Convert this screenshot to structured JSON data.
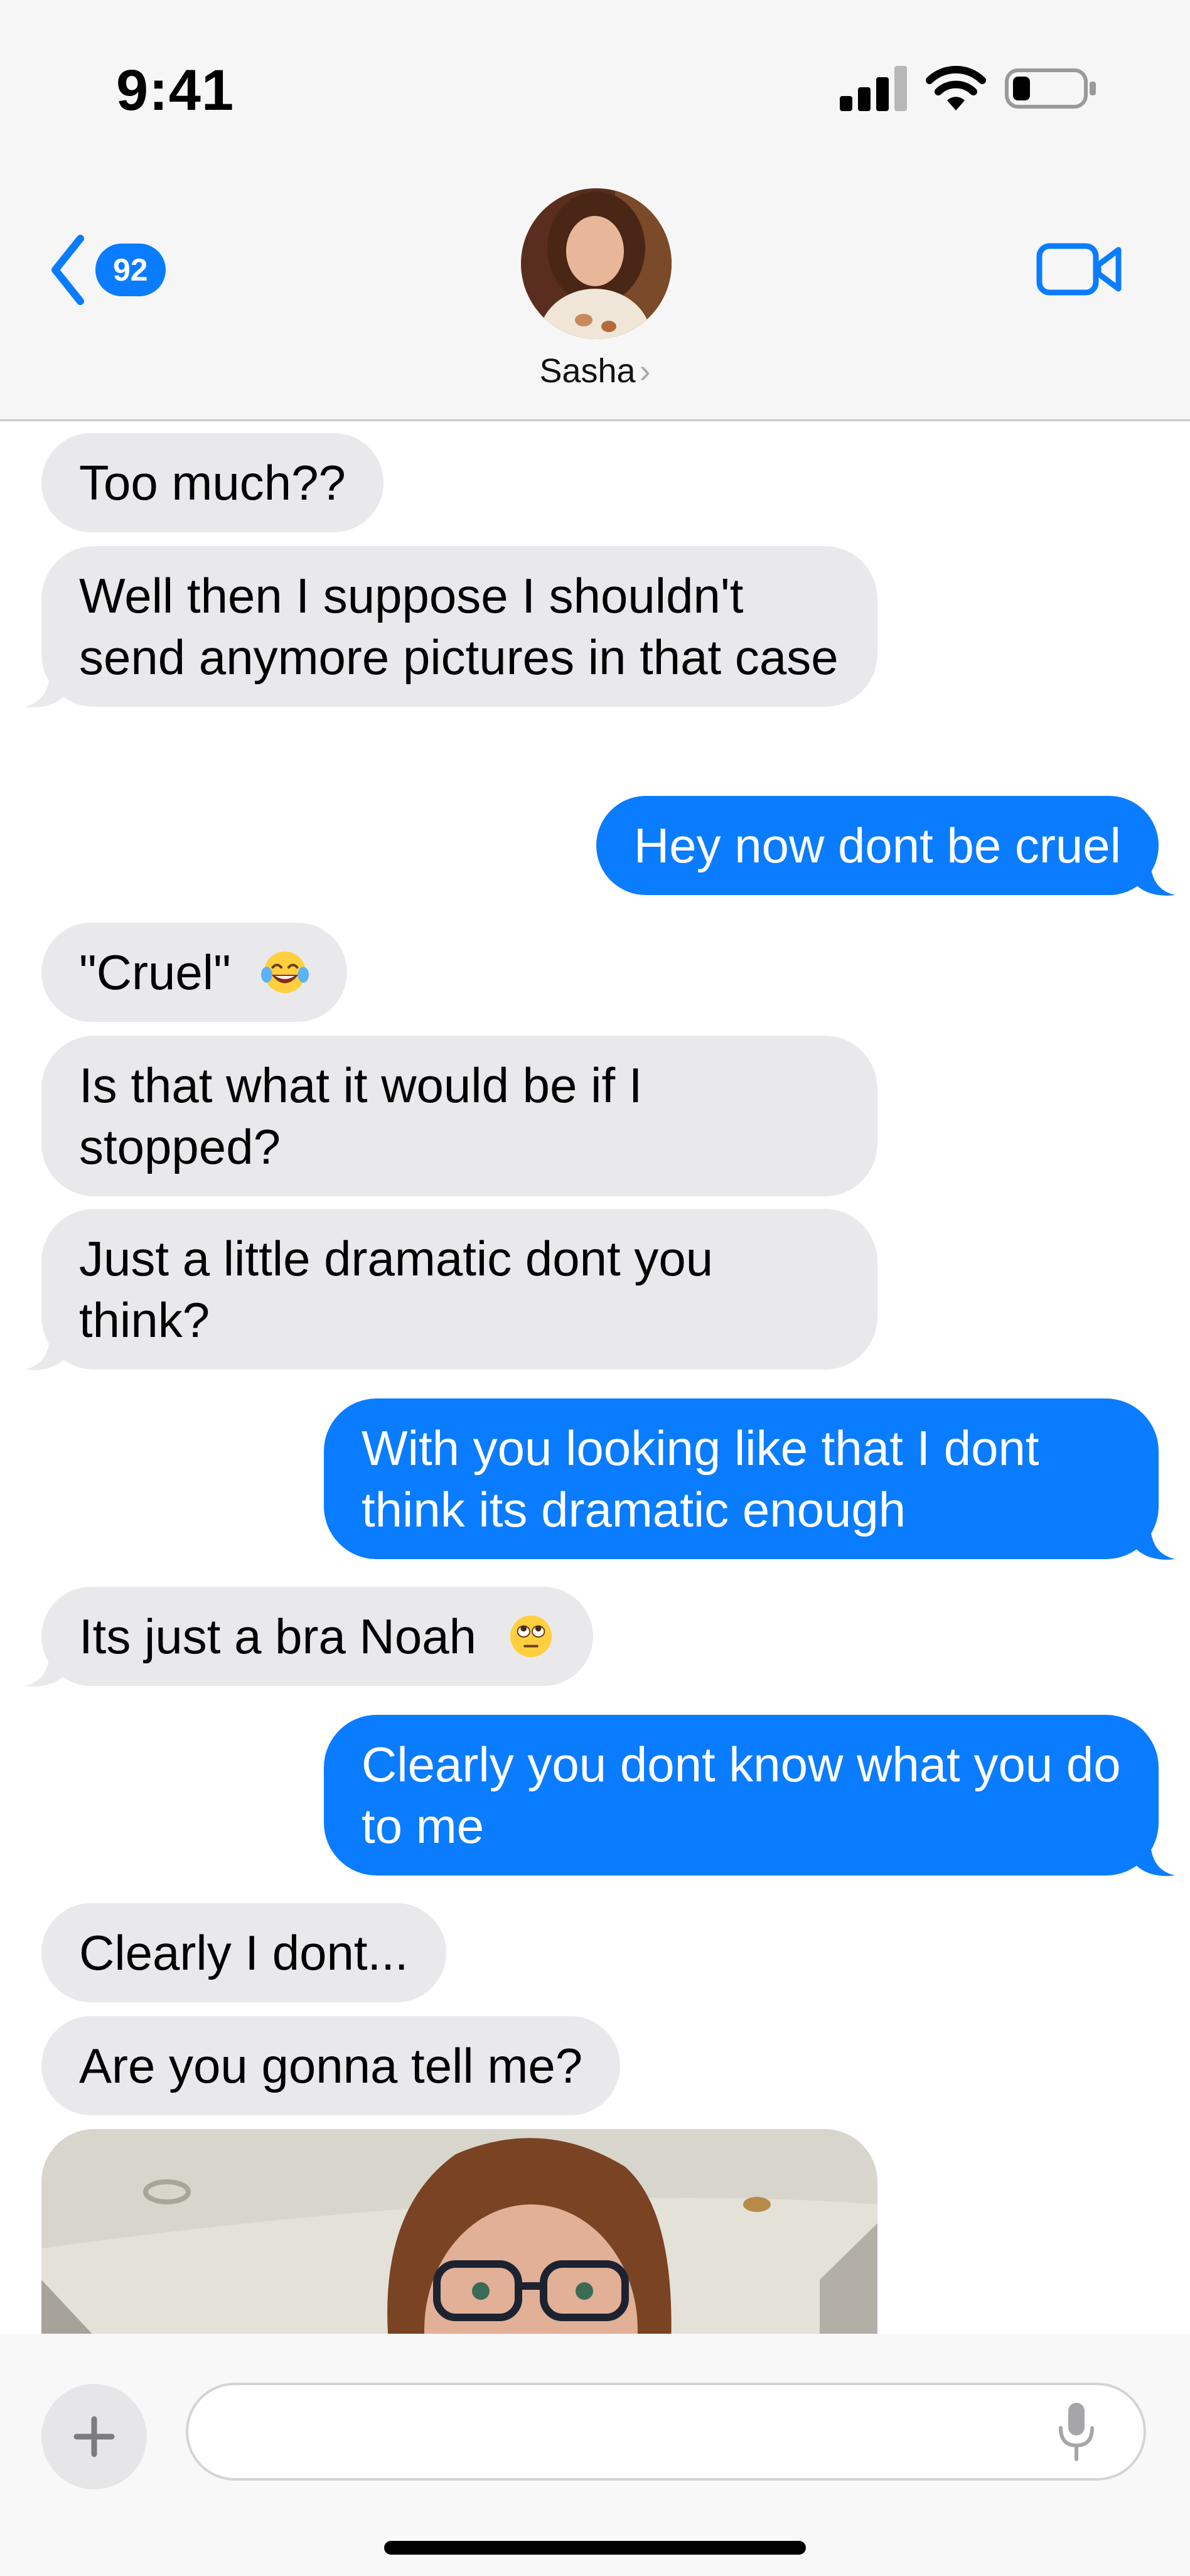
{
  "status_bar": {
    "time": "9:41",
    "battery_level": 0.25
  },
  "header": {
    "back_badge": "92",
    "contact_name": "Sasha",
    "contact_chevron": "›",
    "icons": [
      "chevron-left-icon",
      "video-camera-icon"
    ]
  },
  "messages": [
    {
      "sender": "contact",
      "text": "Too much??"
    },
    {
      "sender": "contact",
      "text": "Well then I suppose I shouldn't send anymore pictures in that case"
    },
    {
      "sender": "me",
      "text": "Hey now dont be cruel"
    },
    {
      "sender": "contact",
      "text": "\"Cruel\"",
      "emoji": "laughing-tears-emoji"
    },
    {
      "sender": "contact",
      "text": "Is that what it would be if I stopped?"
    },
    {
      "sender": "contact",
      "text": "Just a little dramatic dont you think?"
    },
    {
      "sender": "me",
      "text": "With you looking like that I dont think its dramatic enough"
    },
    {
      "sender": "contact",
      "text": "Its just a bra Noah",
      "emoji": "eye-roll-emoji"
    },
    {
      "sender": "me",
      "text": "Clearly you dont know what you do to me"
    },
    {
      "sender": "contact",
      "text": "Clearly I dont..."
    },
    {
      "sender": "contact",
      "text": "Are you gonna tell me?"
    },
    {
      "sender": "contact",
      "type": "photo"
    }
  ],
  "composer": {
    "input_placeholder": "",
    "icons": [
      "plus-icon",
      "microphone-icon"
    ]
  },
  "colors": {
    "outgoing": "#0a7cff",
    "incoming": "#e9e9eb",
    "accent": "#0a7cff"
  }
}
